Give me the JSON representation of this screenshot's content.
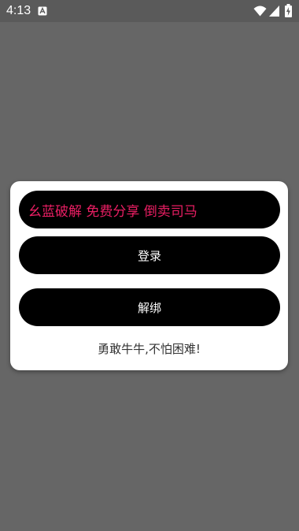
{
  "status_bar": {
    "time": "4:13",
    "notification_icon": "a-box-icon",
    "wifi_icon": "wifi-icon",
    "signal_icon": "signal-icon",
    "battery_icon": "battery-charging-icon"
  },
  "dialog": {
    "input": {
      "value": "幺蓝破解 免费分享 倒卖司马"
    },
    "login_button": "登录",
    "unbind_button": "解绑",
    "footer_text": "勇敢牛牛,不怕困难!",
    "colors": {
      "input_text": "#e91e63",
      "button_bg": "#000000",
      "dialog_bg": "#ffffff",
      "backdrop": "#666666"
    }
  }
}
